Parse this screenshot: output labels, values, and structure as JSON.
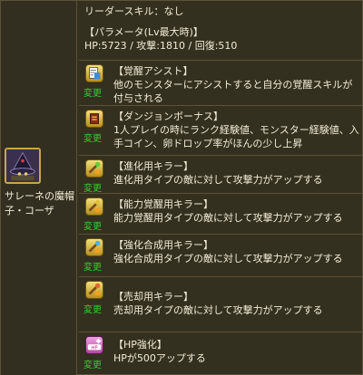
{
  "character": {
    "name": "サレーネの魔帽子・コーザ"
  },
  "leader_skill": "リーダースキル：なし",
  "params": {
    "title": "【パラメータ(Lv最大時)】",
    "values": "HP:5723 / 攻撃:1810 / 回復:510"
  },
  "change_label": "変更",
  "awakenings": [
    {
      "icon": "awakening-assist-icon",
      "title": "【覚醒アシスト】",
      "desc": "他のモンスターにアシストすると自分の覚醒スキルが付与される"
    },
    {
      "icon": "dungeon-bonus-icon",
      "title": "【ダンジョンボーナス】",
      "desc": "1人プレイの時にランク経験値、モンスター経験値、入手コイン、卵ドロップ率がほんの少し上昇"
    },
    {
      "icon": "evo-killer-icon",
      "title": "【進化用キラー】",
      "desc": "進化用タイプの敵に対して攻撃力がアップする"
    },
    {
      "icon": "awaken-killer-icon",
      "title": "【能力覚醒用キラー】",
      "desc": "能力覚醒用タイプの敵に対して攻撃力がアップする"
    },
    {
      "icon": "enhance-killer-icon",
      "title": "【強化合成用キラー】",
      "desc": "強化合成用タイプの敵に対して攻撃力がアップする"
    },
    {
      "icon": "sell-killer-icon",
      "title": "【売却用キラー】",
      "desc": "売却用タイプの敵に対して攻撃力がアップする"
    },
    {
      "icon": "hp-plus-icon",
      "title": "【HP強化】",
      "desc": "HPが500アップする"
    }
  ]
}
